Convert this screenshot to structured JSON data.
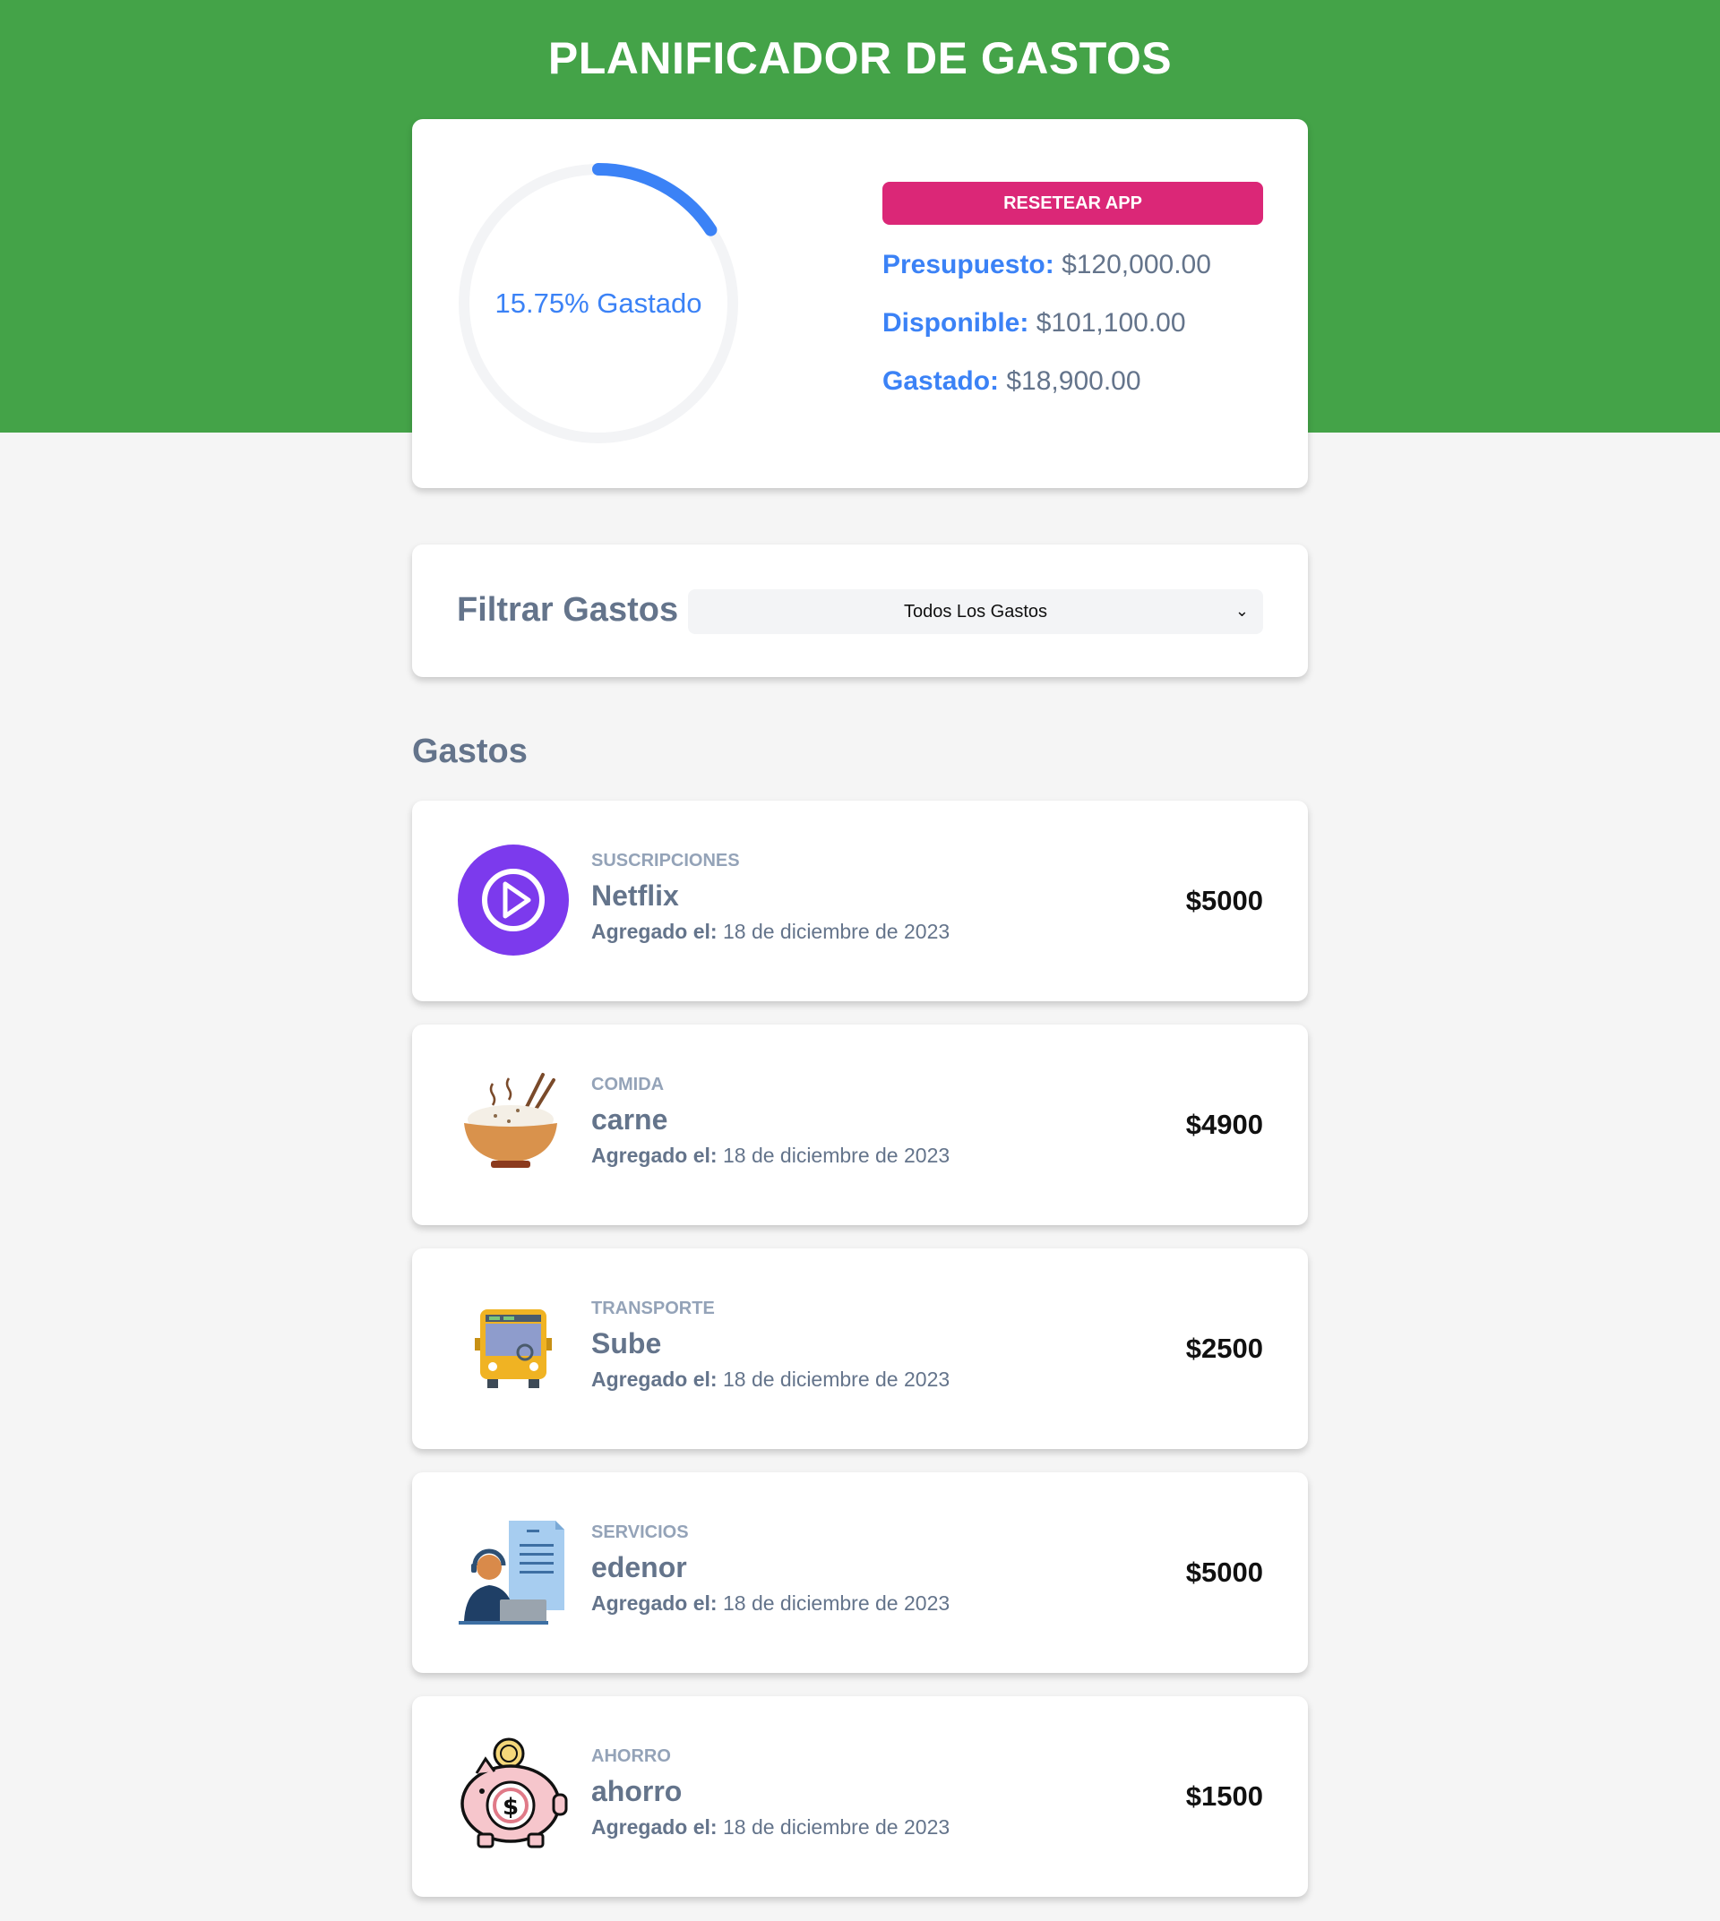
{
  "app": {
    "title": "PLANIFICADOR DE GASTOS"
  },
  "budget": {
    "percent_spent": 15.75,
    "progress_text": "15.75% Gastado",
    "reset_label": "RESETEAR APP",
    "presupuesto_label": "Presupuesto:",
    "presupuesto_value": "$120,000.00",
    "disponible_label": "Disponible:",
    "disponible_value": "$101,100.00",
    "gastado_label": "Gastado:",
    "gastado_value": "$18,900.00"
  },
  "filter": {
    "label": "Filtrar Gastos",
    "selected": "Todos Los Gastos"
  },
  "expenses_title": "Gastos",
  "date_label": "Agregado el:",
  "expenses": [
    {
      "category": "SUSCRIPCIONES",
      "name": "Netflix",
      "date": "18 de diciembre de 2023",
      "amount": "$5000",
      "icon": "play-icon"
    },
    {
      "category": "COMIDA",
      "name": "carne",
      "date": "18 de diciembre de 2023",
      "amount": "$4900",
      "icon": "rice-bowl-icon"
    },
    {
      "category": "TRANSPORTE",
      "name": "Sube",
      "date": "18 de diciembre de 2023",
      "amount": "$2500",
      "icon": "bus-icon"
    },
    {
      "category": "SERVICIOS",
      "name": "edenor",
      "date": "18 de diciembre de 2023",
      "amount": "$5000",
      "icon": "service-agent-icon"
    },
    {
      "category": "AHORRO",
      "name": "ahorro",
      "date": "18 de diciembre de 2023",
      "amount": "$1500",
      "icon": "piggy-bank-icon"
    }
  ],
  "colors": {
    "header_green": "#44a348",
    "accent_blue": "#3b82f6",
    "reset_pink": "#db2777",
    "text_slate": "#64748b"
  }
}
